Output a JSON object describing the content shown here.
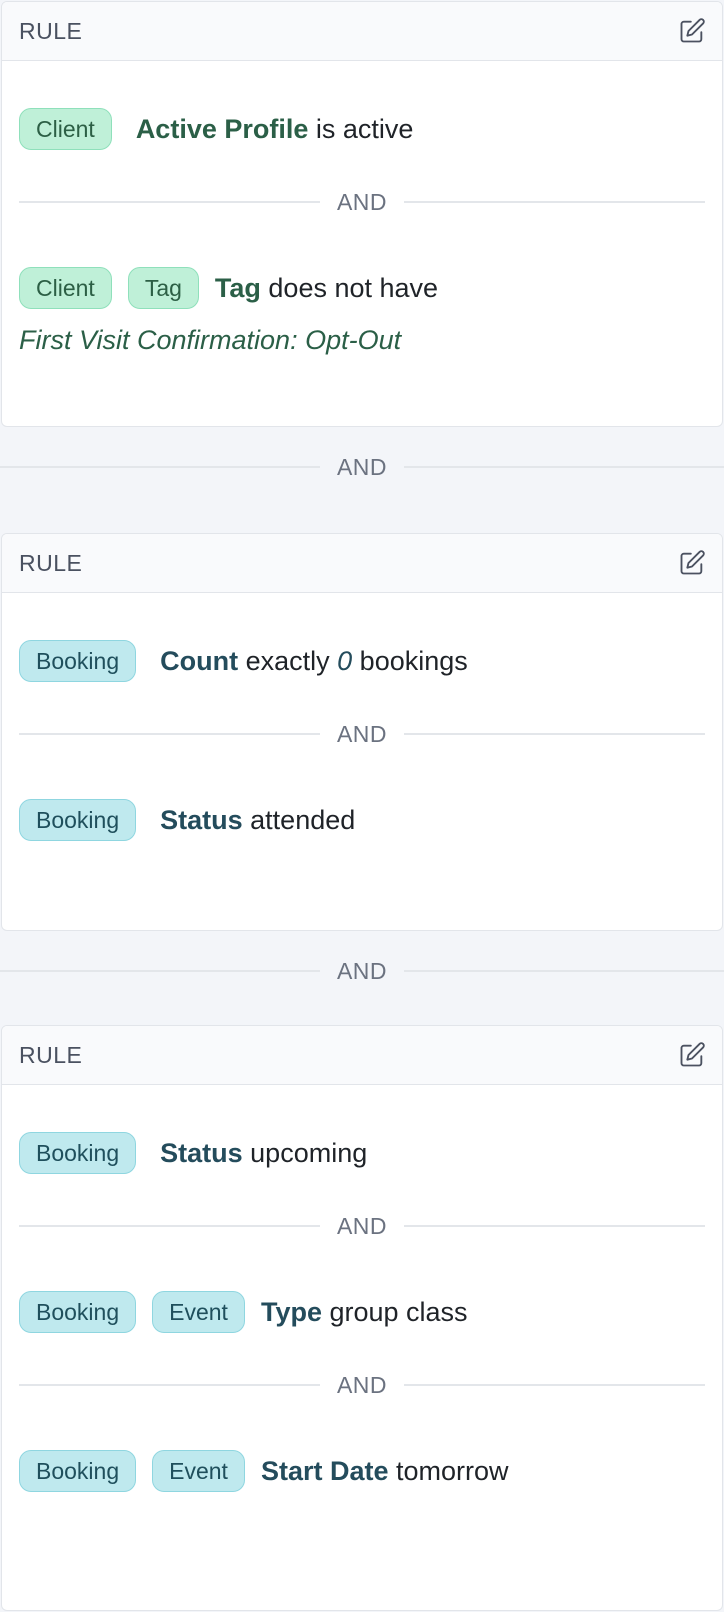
{
  "rules": [
    {
      "title": "RULE",
      "conditions": [
        {
          "badges": [
            "Client"
          ],
          "field": "Active Profile",
          "text_after": " is active"
        },
        {
          "badges": [
            "Client",
            "Tag"
          ],
          "field": "Tag",
          "text_mid": " does not have ",
          "value": "First Visit Confirmation: Opt-Out"
        }
      ],
      "and_label": "AND"
    },
    {
      "title": "RULE",
      "conditions": [
        {
          "badges": [
            "Booking"
          ],
          "field": "Count",
          "text_mid": " exactly ",
          "value": "0",
          "text_after": " bookings"
        },
        {
          "badges": [
            "Booking"
          ],
          "field": "Status",
          "text_after": " attended"
        }
      ],
      "and_label": "AND"
    },
    {
      "title": "RULE",
      "conditions": [
        {
          "badges": [
            "Booking"
          ],
          "field": "Status",
          "text_after": " upcoming"
        },
        {
          "badges": [
            "Booking",
            "Event"
          ],
          "field": "Type",
          "text_after": " group class"
        },
        {
          "badges": [
            "Booking",
            "Event"
          ],
          "field": "Start Date",
          "text_after": " tomorrow"
        }
      ],
      "and_label": "AND"
    }
  ],
  "between_rules_label": "AND",
  "icons": {
    "edit": "edit-icon"
  },
  "colors": {
    "client_badge_bg": "#bff0d8",
    "booking_badge_bg": "#bfe9ee",
    "client_field": "#2b5f47",
    "booking_field": "#244c5c"
  }
}
